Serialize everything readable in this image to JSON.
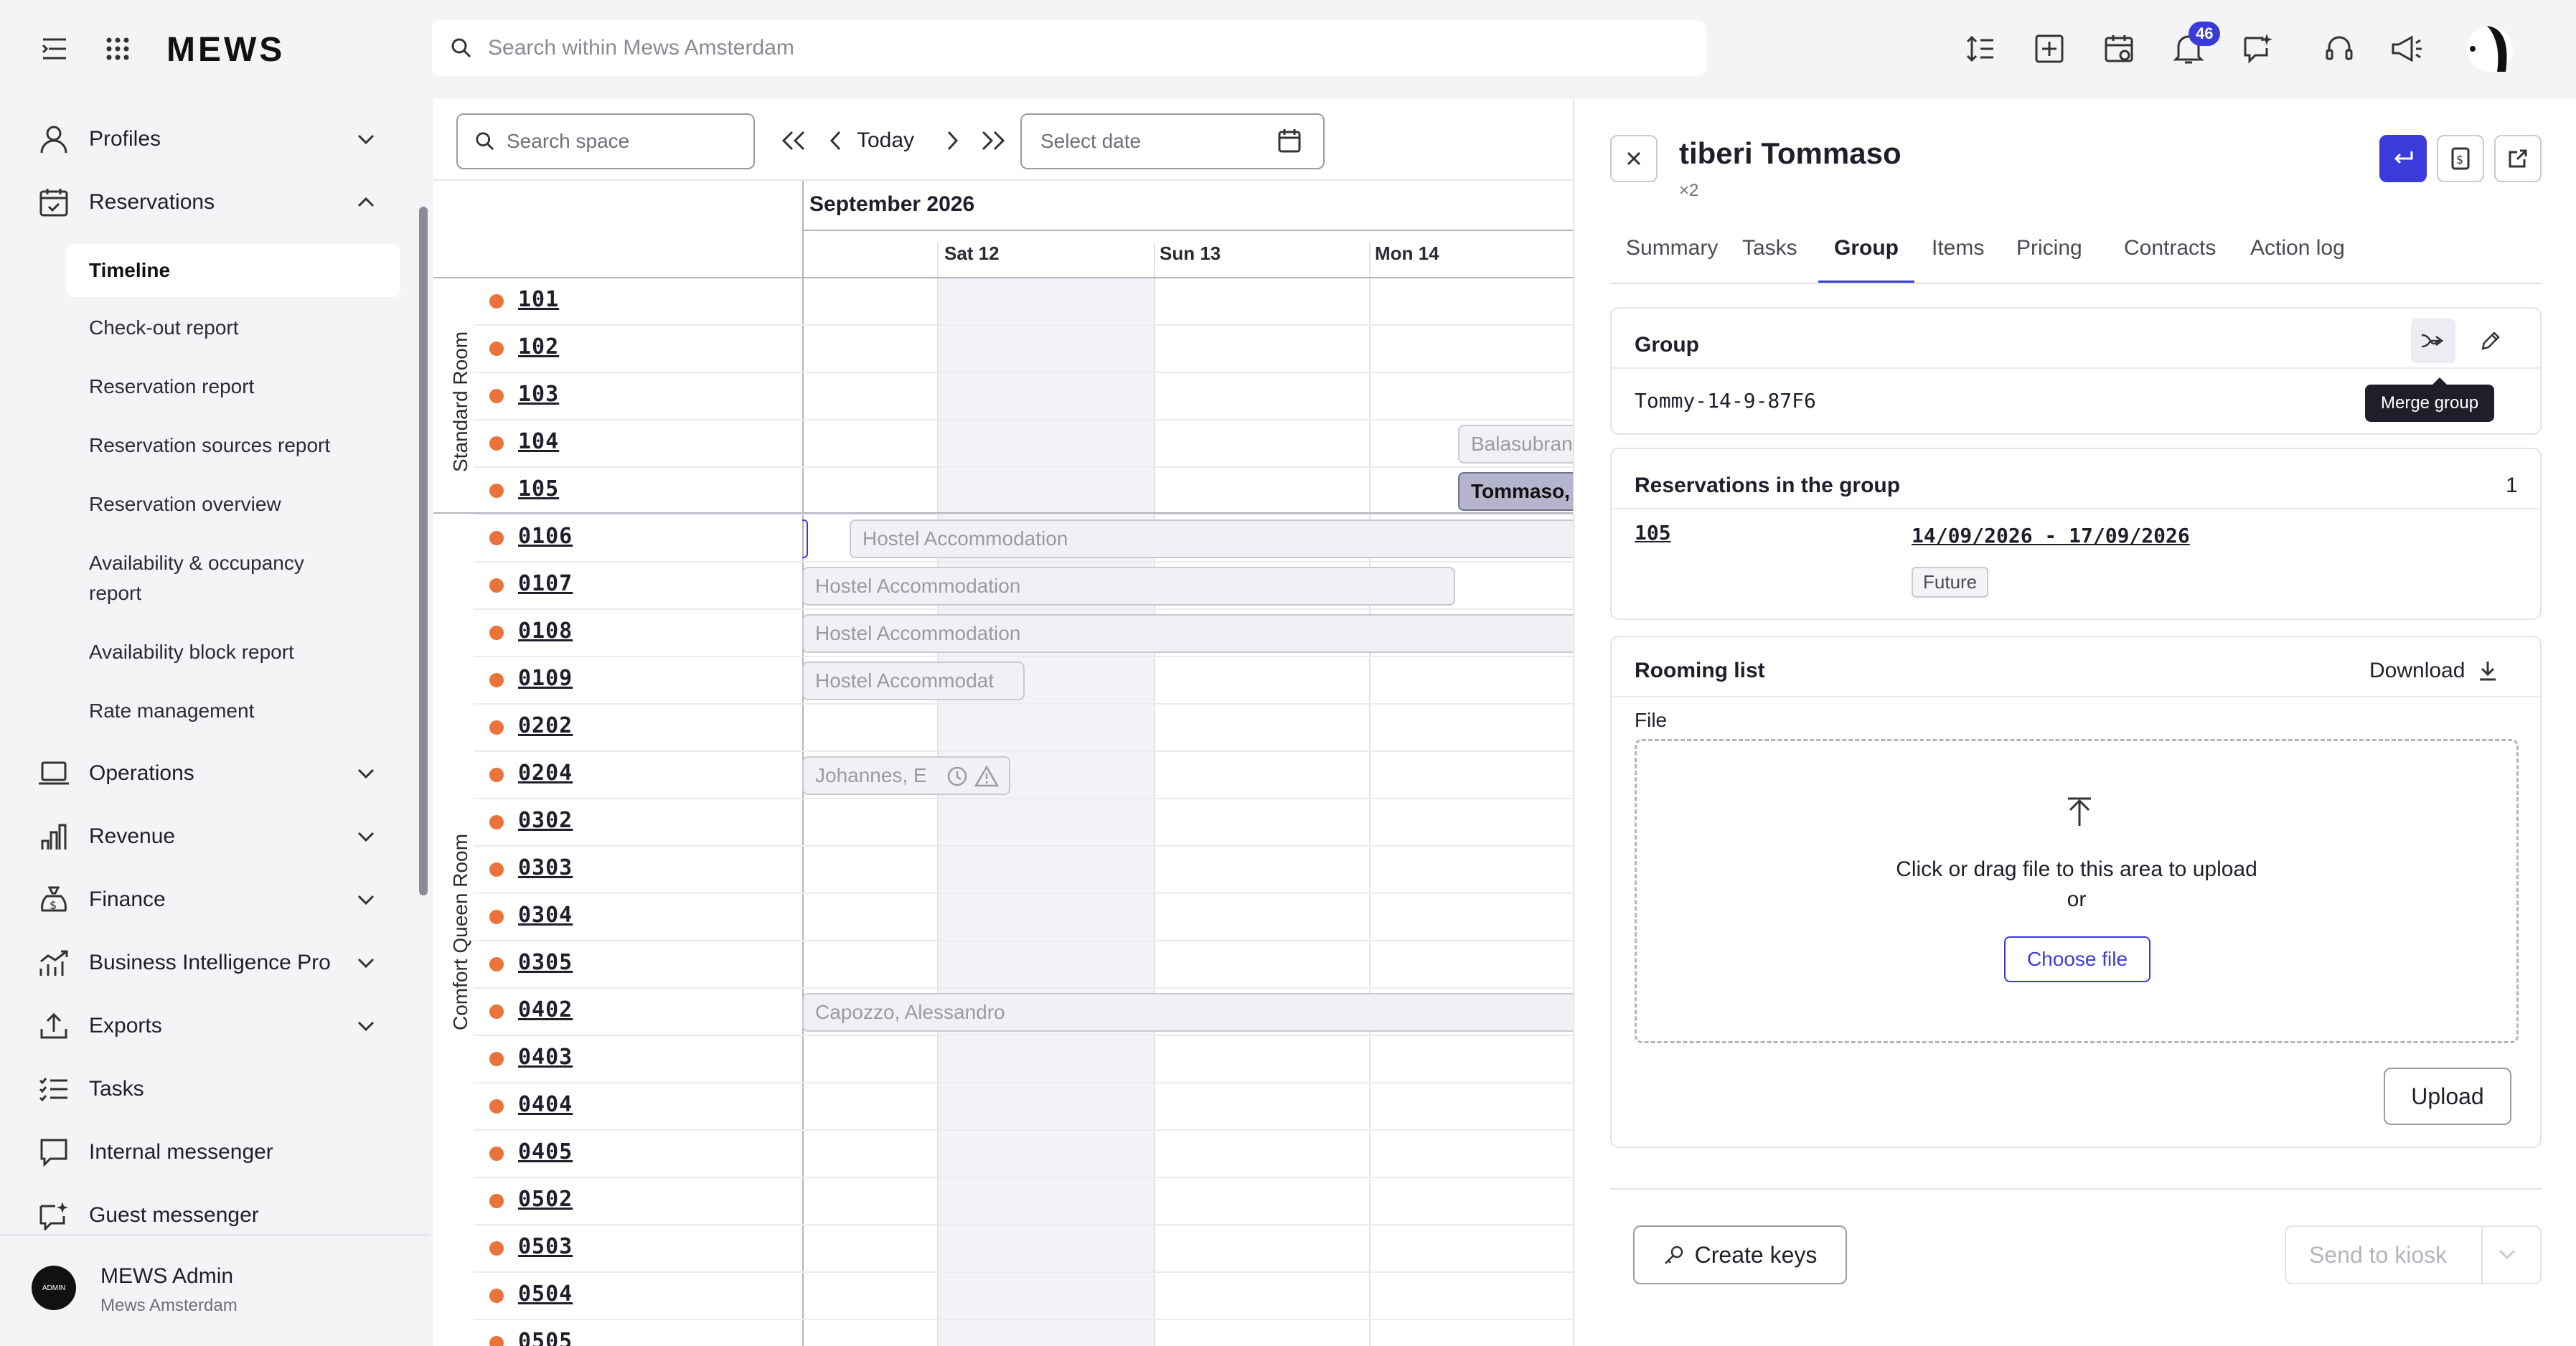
{
  "app": {
    "logo": "MEWS",
    "search_placeholder": "Search within Mews Amsterdam",
    "notification_count": "46"
  },
  "sidebar": {
    "items": [
      {
        "label": "Profiles"
      },
      {
        "label": "Reservations"
      },
      {
        "label": "Operations"
      },
      {
        "label": "Revenue"
      },
      {
        "label": "Finance"
      },
      {
        "label": "Business Intelligence Pro"
      },
      {
        "label": "Exports"
      },
      {
        "label": "Tasks"
      },
      {
        "label": "Internal messenger"
      },
      {
        "label": "Guest messenger"
      }
    ],
    "reservation_subitems": [
      "Timeline",
      "Check-out report",
      "Reservation report",
      "Reservation sources report",
      "Reservation overview",
      "Availability & occupancy report",
      "Availability block report",
      "Rate management"
    ],
    "user": {
      "avatar_text": "ADMIN",
      "name": "MEWS Admin",
      "property": "Mews Amsterdam"
    }
  },
  "timeline": {
    "search_placeholder": "Search space",
    "today_label": "Today",
    "date_placeholder": "Select date",
    "month": "September 2026",
    "days": [
      "Sat 12",
      "Sun 13",
      "Mon 14"
    ],
    "categories": [
      "Standard Room",
      "Comfort Queen Room"
    ],
    "rooms": [
      "101",
      "102",
      "103",
      "104",
      "105",
      "0106",
      "0107",
      "0108",
      "0109",
      "0202",
      "0204",
      "0302",
      "0303",
      "0304",
      "0305",
      "0402",
      "0403",
      "0404",
      "0405",
      "0502",
      "0503",
      "0504",
      "0505"
    ],
    "reservations": [
      {
        "label": "Balasubran"
      },
      {
        "label": "Tommaso,"
      },
      {
        "label": "Hostel Accommodation"
      },
      {
        "label": "Hostel Accommodation"
      },
      {
        "label": "Hostel Accommodation"
      },
      {
        "label": "Hostel Accommodat"
      },
      {
        "label": "Johannes, E"
      },
      {
        "label": "Capozzo, Alessandro"
      }
    ]
  },
  "detail": {
    "guest_name": "tiberi Tommaso",
    "guest_count": "×2",
    "tabs": [
      "Summary",
      "Tasks",
      "Group",
      "Items",
      "Pricing",
      "Contracts",
      "Action log"
    ],
    "active_tab": "Group",
    "group": {
      "title": "Group",
      "name": "Tommy-14-9-87F6",
      "merge_tooltip": "Merge group"
    },
    "reservations_in_group": {
      "title": "Reservations in the group",
      "count": "1",
      "room": "105",
      "dates": "14/09/2026 - 17/09/2026",
      "status": "Future"
    },
    "rooming_list": {
      "title": "Rooming list",
      "download_label": "Download",
      "file_label": "File",
      "upload_hint": "Click or drag file to this area to upload",
      "or_text": "or",
      "choose_file_label": "Choose file",
      "upload_label": "Upload"
    },
    "footer": {
      "create_keys_label": "Create keys",
      "send_kiosk_label": "Send to kiosk"
    }
  }
}
